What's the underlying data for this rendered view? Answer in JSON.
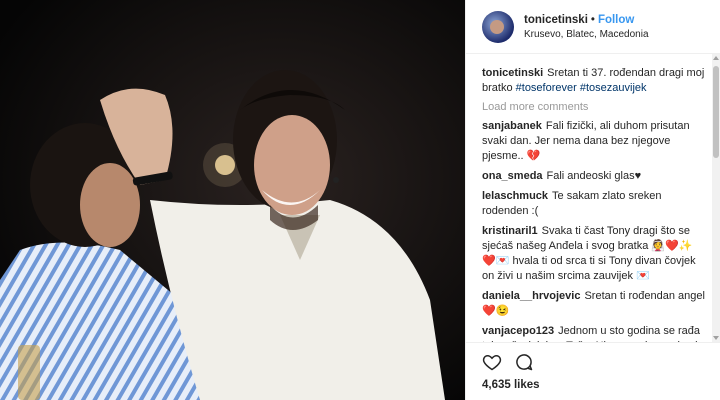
{
  "header": {
    "username": "tonicetinski",
    "separator": "•",
    "follow_label": "Follow",
    "location": "Krusevo, Blatec, Macedonia"
  },
  "caption": {
    "username": "tonicetinski",
    "text": "Sretan ti 37. rođendan dragi moj bratko ",
    "tag1": "#toseforever",
    "tag2": "#tosezauvijek"
  },
  "load_more": "Load more comments",
  "comments": [
    {
      "user": "sanjabanek",
      "text": "Fali fizički, ali duhom prisutan svaki dan. Jer nema dana bez njegove pjesme.. 💔"
    },
    {
      "user": "ona_smeda",
      "text": "Fali andeoski glas♥"
    },
    {
      "user": "lelaschmuck",
      "text": "Te sakam zlato sreken rodenden :("
    },
    {
      "user": "kristinaril1",
      "text": "Svaka ti čast Tony dragi što se sjećaš našeg Anđela i svog bratka 👰❤️✨❤️💌 hvala ti od srca ti si Tony divan čovjek on živi u našim srcima zauvijek 💌"
    },
    {
      "user": "daniela__hrvojevic",
      "text": "Sretan ti rođendan angel ❤️😉"
    },
    {
      "user": "vanjacepo123",
      "text": "Jednom u sto godina se rađa takav čovjek kao Toše. Njegove pjesme imaju neviđenu emociju jel se vidi da ih"
    }
  ],
  "likes": "4,635 likes",
  "icons": [
    "heart-icon",
    "comment-icon"
  ],
  "colors": {
    "follow": "#3897f0",
    "hashtag": "#003569"
  }
}
